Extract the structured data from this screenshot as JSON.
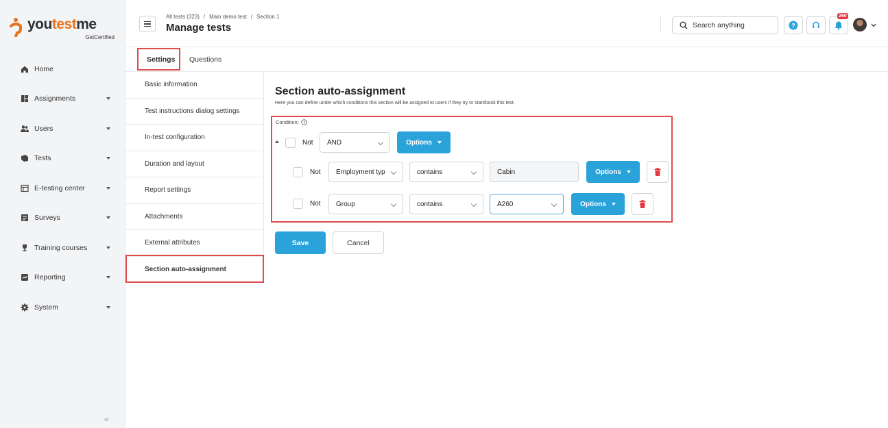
{
  "brand": {
    "name_prefix": "you",
    "name_accent": "test",
    "name_suffix": "me",
    "tagline": "GetCertified"
  },
  "sidebar": {
    "items": [
      {
        "label": "Home",
        "icon": "home-icon",
        "expandable": false
      },
      {
        "label": "Assignments",
        "icon": "assignments-icon",
        "expandable": true
      },
      {
        "label": "Users",
        "icon": "users-icon",
        "expandable": true
      },
      {
        "label": "Tests",
        "icon": "tests-icon",
        "expandable": true
      },
      {
        "label": "E-testing center",
        "icon": "e-testing-icon",
        "expandable": true
      },
      {
        "label": "Surveys",
        "icon": "surveys-icon",
        "expandable": true
      },
      {
        "label": "Training courses",
        "icon": "trophy-icon",
        "expandable": true
      },
      {
        "label": "Reporting",
        "icon": "reporting-icon",
        "expandable": true
      },
      {
        "label": "System",
        "icon": "gear-icon",
        "expandable": true
      }
    ],
    "collapse_glyph": "«"
  },
  "header": {
    "breadcrumb": [
      "All tests (323)",
      "Main demo test",
      "Section 1"
    ],
    "breadcrumb_sep": "/",
    "title": "Manage tests",
    "search_placeholder": "Search anything",
    "notification_count": "260"
  },
  "tabs": [
    {
      "label": "Settings",
      "active": true
    },
    {
      "label": "Questions",
      "active": false
    }
  ],
  "settings_menu": [
    {
      "label": "Basic information",
      "active": false
    },
    {
      "label": "Test instructions dialog settings",
      "active": false
    },
    {
      "label": "In-test configuration",
      "active": false
    },
    {
      "label": "Duration and layout",
      "active": false
    },
    {
      "label": "Report settings",
      "active": false
    },
    {
      "label": "Attachments",
      "active": false
    },
    {
      "label": "External attributes",
      "active": false
    },
    {
      "label": "Section auto-assignment",
      "active": true
    }
  ],
  "section": {
    "title": "Section auto-assignment",
    "subtitle": "Here you can define under which conditions this section will be assigned to users if they try to start/book this test.",
    "condition_label": "Condition:",
    "group": {
      "not_label": "Not",
      "operator": "AND",
      "options_label": "Options"
    },
    "rules": [
      {
        "not_label": "Not",
        "field": "Employment typ",
        "comparator": "contains",
        "value": "Cabin",
        "options_label": "Options"
      },
      {
        "not_label": "Not",
        "field": "Group",
        "comparator": "contains",
        "value": "A260",
        "options_label": "Options"
      }
    ]
  },
  "actions": {
    "save_label": "Save",
    "cancel_label": "Cancel"
  },
  "colors": {
    "primary": "#2aa3db",
    "danger": "#e0393e",
    "highlight": "#e04b4b",
    "brand_accent": "#e8731c"
  }
}
